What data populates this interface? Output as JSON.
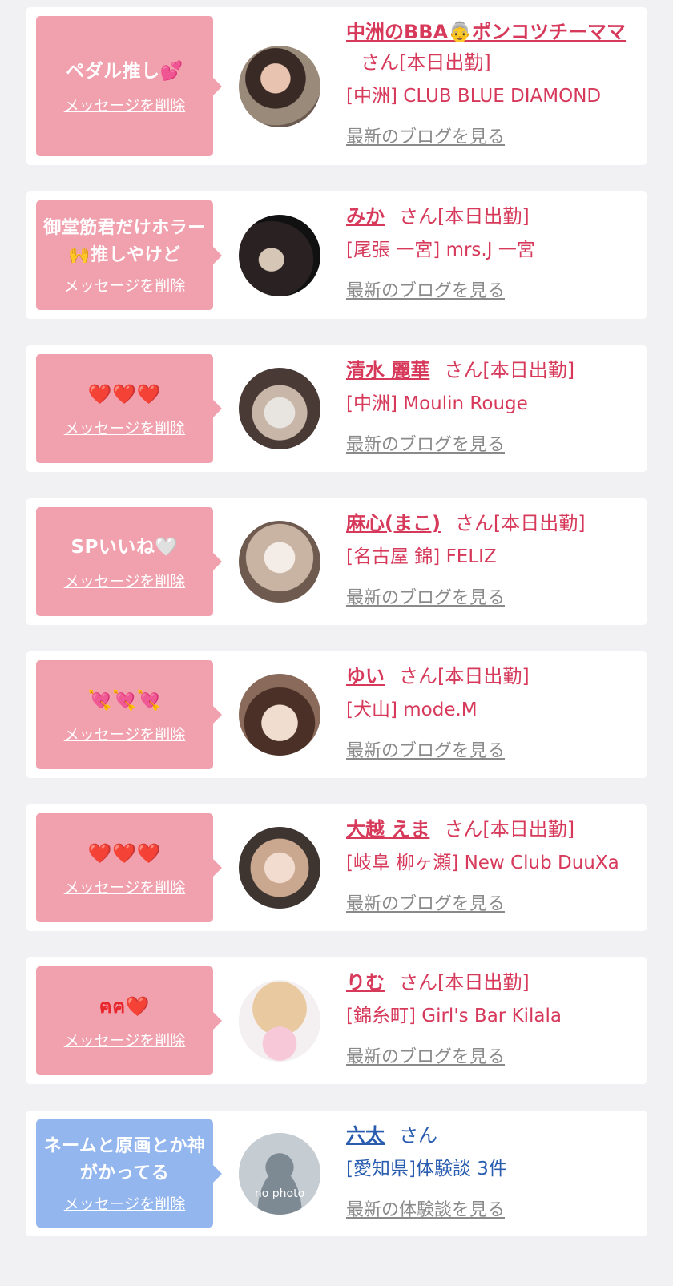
{
  "colors": {
    "pink": "#f1a0ad",
    "blue": "#93b6ee",
    "name_pink": "#d6395a",
    "name_blue": "#2a5db0",
    "link_gray": "#8a8a8a"
  },
  "cards": [
    {
      "message": "ペダル推し💕",
      "delete": "メッセージを削除",
      "name": "中洲のBBA👵ポンコツチーママ",
      "suffix": "さん[本日出勤]",
      "shop": "[中洲] CLUB BLUE DIAMOND",
      "link": "最新のブログを見る"
    },
    {
      "message": "御堂筋君だけホラー🙌推しやけど",
      "delete": "メッセージを削除",
      "name": "みか",
      "suffix": "さん[本日出勤]",
      "shop": "[尾張 一宮] mrs.J 一宮",
      "link": "最新のブログを見る"
    },
    {
      "message": "❤️❤️❤️",
      "delete": "メッセージを削除",
      "name": "清水 麗華",
      "suffix": "さん[本日出勤]",
      "shop": "[中洲] Moulin Rouge",
      "link": "最新のブログを見る"
    },
    {
      "message": "SPいいね🤍",
      "delete": "メッセージを削除",
      "name": "麻心(まこ)",
      "suffix": "さん[本日出勤]",
      "shop": "[名古屋 錦] FELIZ",
      "link": "最新のブログを見る"
    },
    {
      "message": "💘💘💘",
      "delete": "メッセージを削除",
      "name": "ゆい",
      "suffix": "さん[本日出勤]",
      "shop": "[犬山] mode.M",
      "link": "最新のブログを見る"
    },
    {
      "message": "❤️❤️❤️",
      "delete": "メッセージを削除",
      "name": "大越 えま",
      "suffix": "さん[本日出勤]",
      "shop": "[岐阜 柳ヶ瀬] New Club DuuXa",
      "link": "最新のブログを見る"
    },
    {
      "message": "ฅ⁠ฅ❤️",
      "delete": "メッセージを削除",
      "name": "りむ",
      "suffix": "さん[本日出勤]",
      "shop": "[錦糸町] Girl's Bar Kilala",
      "link": "最新のブログを見る"
    },
    {
      "message": "ネームと原画とか神がかってる",
      "delete": "メッセージを削除",
      "name": "六太",
      "suffix": "さん",
      "shop": "[愛知県]体験談 3件",
      "link": "最新の体験談を見る",
      "avatar_text": "no photo"
    }
  ]
}
